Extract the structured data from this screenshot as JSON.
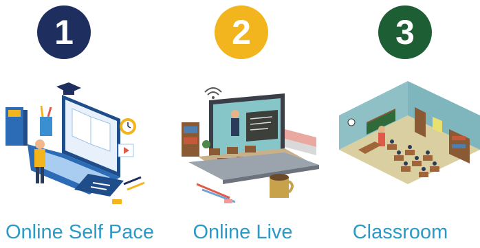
{
  "options": [
    {
      "number": "1",
      "label": "Online Self Pace",
      "color": "#1e2f5f",
      "icon": "laptop-self-study-icon"
    },
    {
      "number": "2",
      "label": "Online Live",
      "color": "#f2b51e",
      "icon": "live-online-class-icon"
    },
    {
      "number": "3",
      "label": "Classroom",
      "color": "#1e5e34",
      "icon": "classroom-icon"
    }
  ],
  "colors": {
    "label": "#2b9ac8"
  }
}
